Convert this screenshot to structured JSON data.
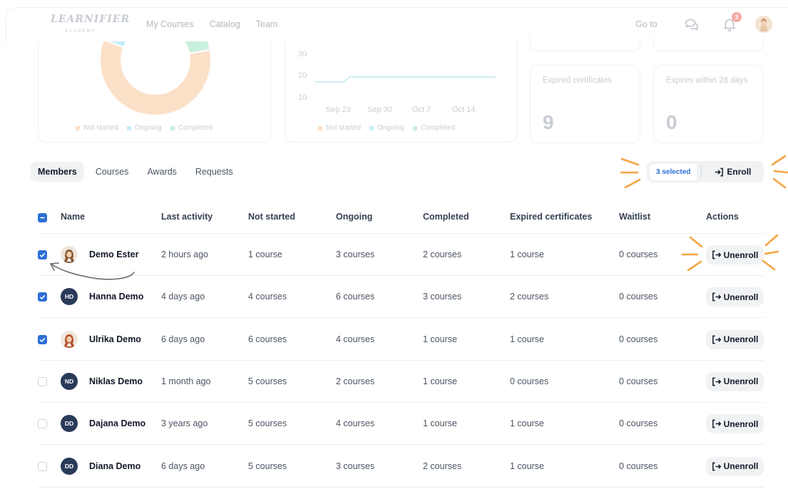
{
  "logo": {
    "main": "LEARNIFIER",
    "sub": "ACADEMY"
  },
  "nav": {
    "items": [
      "My Courses",
      "Catalog",
      "Team"
    ],
    "goto": "Go to",
    "notifications": "3"
  },
  "colors": {
    "accent": "#2d6fd6",
    "not_started": "#fbe0c8",
    "ongoing": "#c7eef8",
    "completed": "#c9f0dd",
    "annotation": "#f4a441"
  },
  "donut": {
    "legend": [
      "Not started",
      "Ongoing",
      "Completed"
    ],
    "values": [
      50,
      10,
      25
    ]
  },
  "linechart": {
    "y_ticks": [
      "30",
      "20",
      "10"
    ],
    "x_ticks": [
      "Sep 23",
      "Sep 30",
      "Oct 7",
      "Oct 14"
    ],
    "legend": [
      "Not started",
      "Ongoing",
      "Completed"
    ]
  },
  "stats": [
    {
      "label": "Expired certificates",
      "value": "9"
    },
    {
      "label": "Expires within 28 days",
      "value": "0"
    }
  ],
  "tabs": [
    "Members",
    "Courses",
    "Awards",
    "Requests"
  ],
  "bulk": {
    "selected": "3 selected",
    "enroll": "Enroll"
  },
  "table": {
    "headers": [
      "Name",
      "Last activity",
      "Not started",
      "Ongoing",
      "Completed",
      "Expired certificates",
      "Waitlist",
      "Actions"
    ],
    "action_label": "Unenroll",
    "rows": [
      {
        "initials": "",
        "avatar": "photo-woman-brown-hair",
        "name": "Demo Ester",
        "checked": true,
        "last": "2 hours ago",
        "not_started": "1 course",
        "ongoing": "3 courses",
        "completed": "2 courses",
        "expired": "1 course",
        "waitlist": "0 courses"
      },
      {
        "initials": "HD",
        "avatar": "initials",
        "name": "Hanna Demo",
        "checked": true,
        "last": "4 days ago",
        "not_started": "4 courses",
        "ongoing": "6 courses",
        "completed": "3 courses",
        "expired": "2 courses",
        "waitlist": "0 courses"
      },
      {
        "initials": "",
        "avatar": "photo-woman-red-hair",
        "name": "Ulrika Demo",
        "checked": true,
        "last": "6 days ago",
        "not_started": "6 courses",
        "ongoing": "4 courses",
        "completed": "1 course",
        "expired": "1 course",
        "waitlist": "0 courses"
      },
      {
        "initials": "ND",
        "avatar": "initials",
        "name": "Niklas Demo",
        "checked": false,
        "last": "1 month ago",
        "not_started": "5 courses",
        "ongoing": "2 courses",
        "completed": "1 course",
        "expired": "0 courses",
        "waitlist": "0 courses"
      },
      {
        "initials": "DD",
        "avatar": "initials",
        "name": "Dajana Demo",
        "checked": false,
        "last": "3 years ago",
        "not_started": "5 courses",
        "ongoing": "4 courses",
        "completed": "1 course",
        "expired": "1 course",
        "waitlist": "0 courses"
      },
      {
        "initials": "DD",
        "avatar": "initials",
        "name": "Diana Demo",
        "checked": false,
        "last": "6 days ago",
        "not_started": "5 courses",
        "ongoing": "3 courses",
        "completed": "2 courses",
        "expired": "1 course",
        "waitlist": "0 courses"
      }
    ]
  }
}
